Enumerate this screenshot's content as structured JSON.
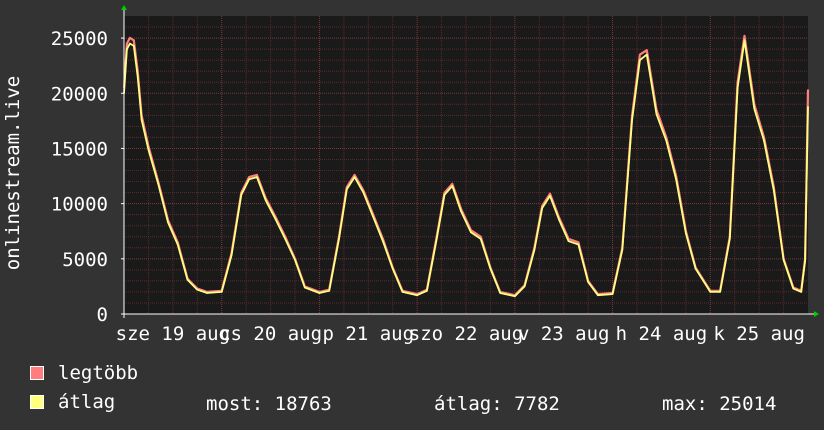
{
  "chart_data": {
    "type": "area",
    "ylabel": "onlinestream.live",
    "ylim": [
      0,
      27000
    ],
    "yticks": [
      "0",
      "5000",
      "10000",
      "15000",
      "20000",
      "25000"
    ],
    "x_tick_labels": [
      "sze 19 aug",
      "cs 20 aug",
      "p 21 aug",
      "szo 22 aug",
      "v 23 aug",
      "h 24 aug",
      "k 25 aug"
    ],
    "x_range_days": [
      0,
      7.0
    ],
    "grid": true,
    "series": [
      {
        "name": "legtöbb",
        "color": "#ff7f7f",
        "x": [
          0,
          0.03,
          0.06,
          0.1,
          0.14,
          0.18,
          0.25,
          0.35,
          0.45,
          0.55,
          0.65,
          0.75,
          0.85,
          1.0,
          1.1,
          1.2,
          1.28,
          1.36,
          1.45,
          1.55,
          1.65,
          1.75,
          1.85,
          2.0,
          2.1,
          2.2,
          2.28,
          2.36,
          2.45,
          2.55,
          2.65,
          2.75,
          2.85,
          3.0,
          3.1,
          3.2,
          3.28,
          3.36,
          3.45,
          3.55,
          3.65,
          3.75,
          3.85,
          4.0,
          4.1,
          4.2,
          4.28,
          4.36,
          4.45,
          4.55,
          4.65,
          4.75,
          4.85,
          5.0,
          5.1,
          5.2,
          5.28,
          5.35,
          5.45,
          5.55,
          5.65,
          5.75,
          5.85,
          6.0,
          6.1,
          6.2,
          6.28,
          6.35,
          6.45,
          6.55,
          6.65,
          6.75,
          6.85,
          6.93,
          6.97,
          7.0
        ],
        "values": [
          20500,
          24500,
          25014,
          24800,
          22000,
          18000,
          15200,
          12000,
          8500,
          6500,
          3200,
          2300,
          2000,
          2100,
          5500,
          11000,
          12400,
          12600,
          10500,
          8800,
          7000,
          5000,
          2500,
          2000,
          2200,
          7000,
          11500,
          12600,
          11200,
          9000,
          6800,
          4200,
          2100,
          1800,
          2200,
          7000,
          11000,
          11800,
          9500,
          7600,
          7000,
          4200,
          2000,
          1700,
          2600,
          6000,
          9800,
          10900,
          8800,
          6800,
          6500,
          3000,
          1800,
          1900,
          6000,
          18000,
          23500,
          23900,
          18500,
          16000,
          12500,
          7500,
          4200,
          2100,
          2100,
          7000,
          21000,
          25200,
          19000,
          16000,
          11500,
          5000,
          2400,
          2100,
          5000,
          20300
        ]
      },
      {
        "name": "átlag",
        "color": "#ffff80",
        "x": [
          0,
          0.03,
          0.06,
          0.1,
          0.14,
          0.18,
          0.25,
          0.35,
          0.45,
          0.55,
          0.65,
          0.75,
          0.85,
          1.0,
          1.1,
          1.2,
          1.28,
          1.36,
          1.45,
          1.55,
          1.65,
          1.75,
          1.85,
          2.0,
          2.1,
          2.2,
          2.28,
          2.36,
          2.45,
          2.55,
          2.65,
          2.75,
          2.85,
          3.0,
          3.1,
          3.2,
          3.28,
          3.36,
          3.45,
          3.55,
          3.65,
          3.75,
          3.85,
          4.0,
          4.1,
          4.2,
          4.28,
          4.36,
          4.45,
          4.55,
          4.65,
          4.75,
          4.85,
          5.0,
          5.1,
          5.2,
          5.28,
          5.35,
          5.45,
          5.55,
          5.65,
          5.75,
          5.85,
          6.0,
          6.1,
          6.2,
          6.28,
          6.35,
          6.45,
          6.55,
          6.65,
          6.75,
          6.85,
          6.93,
          6.97,
          7.0
        ],
        "values": [
          20000,
          24000,
          24500,
          24300,
          21500,
          17600,
          14900,
          11800,
          8300,
          6300,
          3100,
          2200,
          1900,
          2000,
          5300,
          10800,
          12200,
          12400,
          10300,
          8600,
          6800,
          4900,
          2400,
          1900,
          2100,
          6800,
          11300,
          12400,
          11000,
          8800,
          6600,
          4100,
          2000,
          1700,
          2100,
          6800,
          10800,
          11600,
          9300,
          7400,
          6800,
          4100,
          1900,
          1600,
          2500,
          5800,
          9600,
          10700,
          8600,
          6600,
          6300,
          2900,
          1700,
          1800,
          5800,
          17600,
          23000,
          23500,
          18100,
          15700,
          12200,
          7300,
          4100,
          2000,
          2000,
          6800,
          20500,
          24800,
          18600,
          15700,
          11200,
          4900,
          2300,
          2000,
          4800,
          18763
        ]
      }
    ]
  },
  "legend": [
    {
      "label": "legtöbb",
      "color": "#ff7f7f",
      "border": "#ffffff"
    },
    {
      "label": "átlag",
      "color": "#ffff80",
      "border": "#ffffff"
    }
  ],
  "stats": {
    "now": "most: 18763",
    "avg": "átlag: 7782",
    "max": "max: 25014"
  },
  "colors": {
    "background": "#333333",
    "plot_background": "#1a1a1a",
    "minor_grid": "#5a2a2a",
    "major_grid": "#7a3a3a",
    "axis": "#ffffff",
    "arrow": "#00cc00"
  }
}
